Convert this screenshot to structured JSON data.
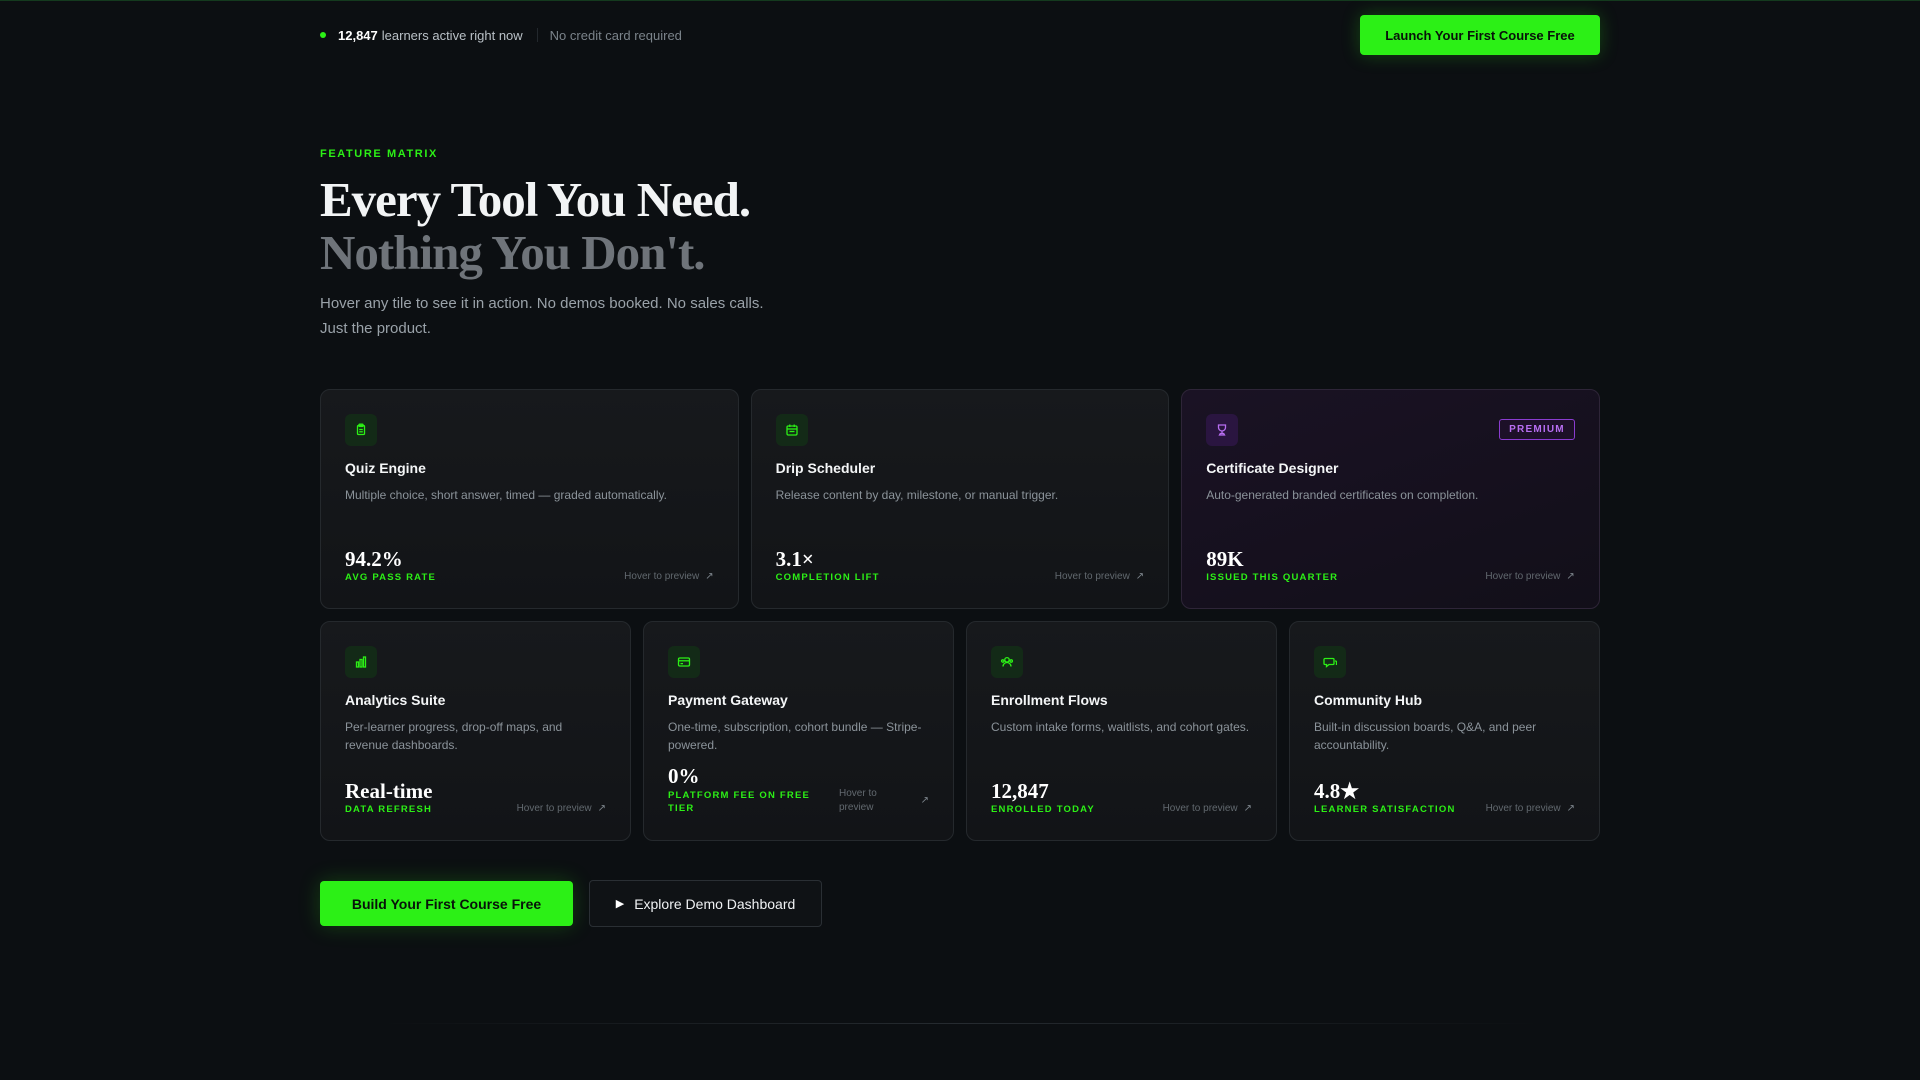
{
  "topbar": {
    "active_count": "12,847",
    "active_text": "learners active right now",
    "note": "No credit card required",
    "launch_label": "Launch Your First Course Free"
  },
  "hero": {
    "eyebrow": "FEATURE MATRIX",
    "headline_line1": "Every Tool You Need.",
    "headline_line2": "Nothing You Don't.",
    "subcopy": "Hover any tile to see it in action. No demos booked. No sales calls. Just the product."
  },
  "colors": {
    "accent": "#2cf016",
    "premium": "#b86ef2",
    "background": "#0c0f12"
  },
  "features": [
    {
      "icon": "clipboard-icon",
      "title": "Quiz Engine",
      "desc": "Multiple choice, short answer, timed — graded automatically.",
      "metric_value": "94.2%",
      "metric_label": "AVG PASS RATE",
      "preview": "Hover to preview"
    },
    {
      "icon": "calendar-icon",
      "title": "Drip Scheduler",
      "desc": "Release content by day, milestone, or manual trigger.",
      "metric_value": "3.1×",
      "metric_label": "COMPLETION LIFT",
      "preview": "Hover to preview"
    },
    {
      "icon": "trophy-icon",
      "title": "Certificate Designer",
      "badge": "PREMIUM",
      "desc": "Auto-generated branded certificates on completion.",
      "metric_value": "89K",
      "metric_label": "ISSUED THIS QUARTER",
      "preview": "Hover to preview"
    },
    {
      "icon": "bar-chart-icon",
      "title": "Analytics Suite",
      "desc": "Per-learner progress, drop-off maps, and revenue dashboards.",
      "metric_value": "Real-time",
      "metric_label": "DATA REFRESH",
      "preview": "Hover to preview"
    },
    {
      "icon": "credit-card-icon",
      "title": "Payment Gateway",
      "desc": "One-time, subscription, cohort bundle — Stripe-powered.",
      "metric_value": "0%",
      "metric_label": "PLATFORM FEE ON FREE TIER",
      "preview": "Hover to preview"
    },
    {
      "icon": "users-icon",
      "title": "Enrollment Flows",
      "desc": "Custom intake forms, waitlists, and cohort gates.",
      "metric_value": "12,847",
      "metric_label": "ENROLLED TODAY",
      "preview": "Hover to preview"
    },
    {
      "icon": "chat-icon",
      "title": "Community Hub",
      "desc": "Built-in discussion boards, Q&A, and peer accountability.",
      "metric_value": "4.8★",
      "metric_label": "LEARNER SATISFACTION",
      "preview": "Hover to preview"
    }
  ],
  "cta": {
    "primary_label": "Build Your First Course Free",
    "secondary_label": "Explore Demo Dashboard"
  }
}
